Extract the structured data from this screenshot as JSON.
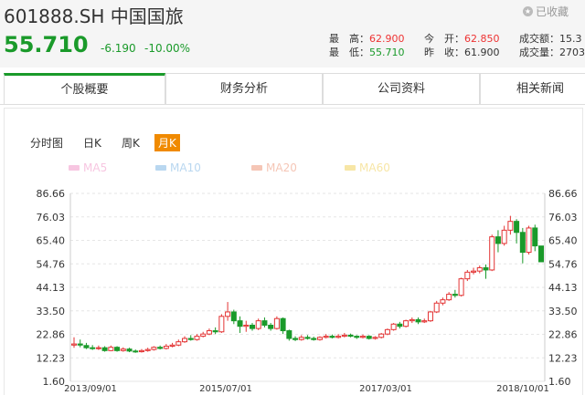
{
  "header": {
    "title": "601888.SH 中国国旅",
    "favorite_label": "已收藏",
    "price": "55.710",
    "change": "-6.190",
    "change_pct": "-10.00%",
    "stats": {
      "high_label": "最　高：",
      "high": "62.900",
      "low_label": "最　低：",
      "low": "55.710",
      "open_label": "今　开：",
      "open": "62.850",
      "prev_close_label": "昨　收：",
      "prev_close": "61.900",
      "turnover_label": "成交额：",
      "turnover": "15.3",
      "volume_label": "成交量：",
      "volume": "2703"
    }
  },
  "tabs": [
    "个股概要",
    "财务分析",
    "公司资料",
    "相关新闻"
  ],
  "chart_tabs": [
    "分时图",
    "日K",
    "周K",
    "月K"
  ],
  "ma_legend": [
    {
      "label": "MA5",
      "color": "#f7c6e1"
    },
    {
      "label": "MA10",
      "color": "#b9d7f0"
    },
    {
      "label": "MA20",
      "color": "#f5c6b6"
    },
    {
      "label": "MA60",
      "color": "#f7e6a6"
    }
  ],
  "colors": {
    "up": "#e33333",
    "down": "#1a9a2a",
    "accent": "#f08a00"
  },
  "chart_data": {
    "type": "candlestick",
    "y_ticks": [
      "86.66",
      "76.03",
      "65.40",
      "54.76",
      "44.13",
      "33.50",
      "22.86",
      "12.23",
      "1.60"
    ],
    "ylim": [
      1.6,
      86.66
    ],
    "x_labels": [
      "2013/09/01",
      "2015/07/01",
      "2017/03/01",
      "2018/10/01"
    ],
    "candles": [
      [
        18.0,
        18.5,
        21.5,
        16.8
      ],
      [
        18.5,
        18.0,
        20.5,
        17.0
      ],
      [
        17.8,
        16.8,
        19.0,
        16.2
      ],
      [
        16.8,
        16.5,
        18.0,
        15.8
      ],
      [
        16.5,
        16.8,
        17.8,
        15.8
      ],
      [
        16.8,
        15.5,
        17.5,
        15.0
      ],
      [
        15.5,
        17.0,
        17.8,
        15.2
      ],
      [
        17.0,
        15.5,
        17.5,
        15.0
      ],
      [
        15.5,
        16.2,
        17.0,
        15.0
      ],
      [
        16.2,
        15.3,
        16.8,
        14.8
      ],
      [
        15.3,
        15.0,
        16.0,
        14.5
      ],
      [
        15.0,
        15.5,
        16.2,
        14.6
      ],
      [
        15.5,
        16.0,
        16.8,
        15.0
      ],
      [
        16.0,
        17.0,
        17.5,
        15.5
      ],
      [
        17.0,
        16.5,
        17.8,
        16.0
      ],
      [
        16.5,
        17.5,
        18.5,
        16.0
      ],
      [
        17.5,
        18.0,
        19.0,
        17.0
      ],
      [
        18.0,
        19.5,
        20.5,
        17.5
      ],
      [
        19.5,
        21.0,
        22.0,
        19.0
      ],
      [
        21.0,
        20.5,
        22.5,
        20.0
      ],
      [
        20.5,
        22.0,
        23.0,
        20.0
      ],
      [
        22.0,
        23.0,
        24.0,
        21.5
      ],
      [
        23.0,
        24.5,
        25.5,
        22.5
      ],
      [
        24.5,
        24.0,
        26.0,
        23.0
      ],
      [
        24.0,
        31.0,
        32.0,
        23.5
      ],
      [
        31.0,
        33.0,
        37.5,
        29.0
      ],
      [
        33.0,
        29.0,
        34.0,
        27.5
      ],
      [
        29.0,
        26.5,
        31.0,
        23.5
      ],
      [
        26.5,
        27.0,
        29.0,
        24.0
      ],
      [
        27.0,
        25.5,
        28.0,
        24.5
      ],
      [
        25.5,
        29.0,
        30.0,
        24.8
      ],
      [
        29.0,
        27.0,
        30.5,
        26.0
      ],
      [
        27.0,
        25.5,
        28.0,
        24.5
      ],
      [
        25.5,
        30.0,
        31.0,
        25.0
      ],
      [
        30.0,
        24.5,
        30.5,
        23.0
      ],
      [
        24.5,
        21.0,
        25.0,
        20.0
      ],
      [
        21.0,
        20.5,
        22.0,
        19.8
      ],
      [
        20.5,
        21.5,
        22.5,
        20.0
      ],
      [
        21.5,
        21.0,
        22.5,
        20.5
      ],
      [
        21.0,
        20.5,
        21.8,
        20.0
      ],
      [
        20.5,
        21.5,
        22.0,
        20.0
      ],
      [
        21.5,
        22.0,
        23.0,
        21.0
      ],
      [
        22.0,
        21.5,
        22.8,
        21.0
      ],
      [
        21.5,
        22.0,
        23.0,
        21.0
      ],
      [
        22.0,
        22.5,
        23.5,
        21.5
      ],
      [
        22.5,
        22.0,
        23.2,
        21.5
      ],
      [
        22.0,
        21.5,
        22.5,
        20.8
      ],
      [
        21.5,
        22.0,
        22.8,
        21.0
      ],
      [
        22.0,
        21.0,
        22.5,
        20.5
      ],
      [
        21.0,
        21.5,
        22.0,
        20.5
      ],
      [
        21.5,
        23.0,
        23.5,
        21.0
      ],
      [
        23.0,
        25.0,
        25.5,
        22.5
      ],
      [
        25.0,
        27.5,
        28.0,
        24.5
      ],
      [
        27.5,
        26.5,
        28.5,
        25.5
      ],
      [
        26.5,
        29.0,
        29.5,
        26.0
      ],
      [
        29.0,
        29.5,
        30.5,
        28.0
      ],
      [
        29.5,
        28.5,
        30.5,
        27.5
      ],
      [
        28.5,
        29.0,
        30.0,
        28.0
      ],
      [
        29.0,
        33.0,
        33.5,
        28.5
      ],
      [
        33.0,
        37.0,
        38.0,
        32.5
      ],
      [
        37.0,
        38.5,
        39.5,
        36.0
      ],
      [
        38.5,
        41.0,
        42.0,
        38.0
      ],
      [
        41.0,
        40.5,
        43.0,
        39.5
      ],
      [
        40.5,
        48.0,
        48.5,
        40.0
      ],
      [
        48.0,
        51.0,
        52.0,
        47.0
      ],
      [
        51.0,
        51.5,
        53.0,
        50.0
      ],
      [
        51.5,
        53.0,
        54.0,
        50.5
      ],
      [
        53.0,
        52.0,
        54.5,
        48.0
      ],
      [
        52.0,
        67.0,
        68.0,
        51.5
      ],
      [
        67.0,
        64.0,
        70.0,
        60.0
      ],
      [
        64.0,
        70.0,
        72.0,
        63.0
      ],
      [
        70.0,
        74.0,
        76.5,
        68.0
      ],
      [
        74.0,
        69.0,
        75.0,
        64.0
      ],
      [
        69.0,
        60.0,
        71.0,
        55.0
      ],
      [
        60.0,
        71.0,
        72.0,
        59.0
      ],
      [
        71.0,
        62.9,
        72.5,
        60.5
      ],
      [
        62.85,
        55.71,
        62.9,
        55.71
      ]
    ]
  }
}
